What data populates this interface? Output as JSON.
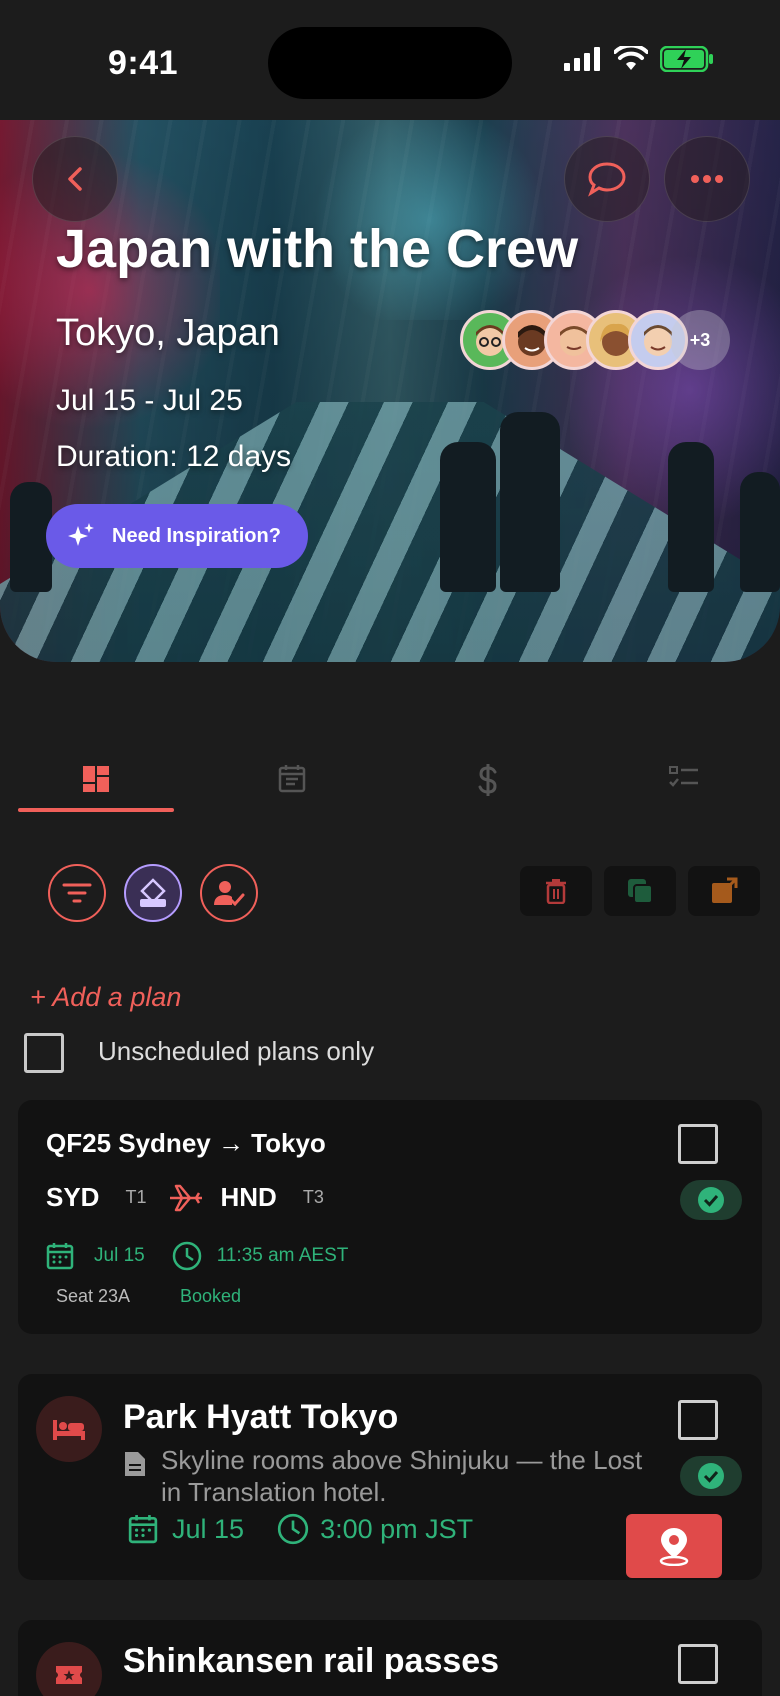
{
  "status_bar": {
    "time": "9:41"
  },
  "hero": {
    "title": "Japan with the Crew",
    "location": "Tokyo, Japan",
    "dates": "Jul 15 - Jul 25",
    "duration": "Duration: 12 days",
    "inspiration_label": "Need Inspiration?",
    "more_members": "+3"
  },
  "tabs": [
    "overview-icon",
    "itinerary-icon",
    "budget-icon",
    "checklist-icon"
  ],
  "add_plan": "+ Add a plan",
  "unscheduled_label": "Unscheduled plans only",
  "flight": {
    "title": "QF25 Sydney → Tokyo",
    "from_code": "SYD",
    "from_terminal": "T1",
    "to_code": "HND",
    "to_terminal": "T3",
    "date": "Jul 15",
    "time": "11:35 am AEST",
    "seat": "Seat 23A",
    "status": "Booked"
  },
  "hotel": {
    "title": "Park Hyatt Tokyo",
    "description": "Skyline rooms above Shinjuku — the Lost in Translation hotel.",
    "date": "Jul 15",
    "time": "3:00 pm JST"
  },
  "rail": {
    "title": "Shinkansen rail passes"
  },
  "colors": {
    "accent": "#f0605a",
    "green": "#2fb37a",
    "purple": "#6a5ae8"
  }
}
